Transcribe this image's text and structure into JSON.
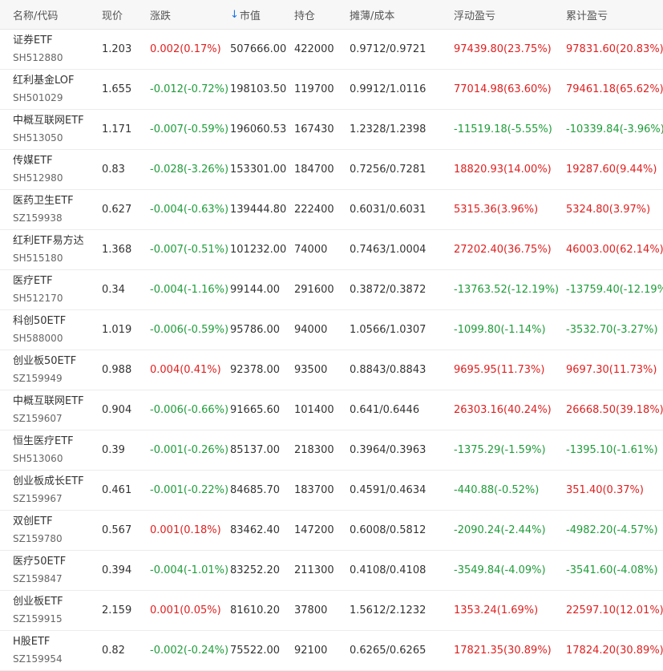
{
  "header": {
    "name_code": "名称/代码",
    "price": "现价",
    "change": "涨跌",
    "sort_arrow": "↓",
    "market_value": "市值",
    "holding": "持仓",
    "cost": "摊薄/成本",
    "float_pl": "浮动盈亏",
    "total_pl": "累计盈亏"
  },
  "colors": {
    "up": "#e02020",
    "down": "#1f9d3a",
    "sort": "#1a73e8"
  },
  "rows": [
    {
      "name": "证券ETF",
      "code": "SH512880",
      "price": "1.203",
      "change": "0.002(0.17%)",
      "change_dir": "up",
      "mv": "507666.00",
      "hold": "422000",
      "cost": "0.9712/0.9721",
      "fpl": "97439.80(23.75%)",
      "fpl_dir": "up",
      "tpl": "97831.60(20.83%)",
      "tpl_dir": "up"
    },
    {
      "name": "红利基金LOF",
      "code": "SH501029",
      "price": "1.655",
      "change": "-0.012(-0.72%)",
      "change_dir": "down",
      "mv": "198103.50",
      "hold": "119700",
      "cost": "0.9912/1.0116",
      "fpl": "77014.98(63.60%)",
      "fpl_dir": "up",
      "tpl": "79461.18(65.62%)",
      "tpl_dir": "up"
    },
    {
      "name": "中概互联网ETF",
      "code": "SH513050",
      "price": "1.171",
      "change": "-0.007(-0.59%)",
      "change_dir": "down",
      "mv": "196060.53",
      "hold": "167430",
      "cost": "1.2328/1.2398",
      "fpl": "-11519.18(-5.55%)",
      "fpl_dir": "down",
      "tpl": "-10339.84(-3.96%)",
      "tpl_dir": "down"
    },
    {
      "name": "传媒ETF",
      "code": "SH512980",
      "price": "0.83",
      "change": "-0.028(-3.26%)",
      "change_dir": "down",
      "mv": "153301.00",
      "hold": "184700",
      "cost": "0.7256/0.7281",
      "fpl": "18820.93(14.00%)",
      "fpl_dir": "up",
      "tpl": "19287.60(9.44%)",
      "tpl_dir": "up"
    },
    {
      "name": "医药卫生ETF",
      "code": "SZ159938",
      "price": "0.627",
      "change": "-0.004(-0.63%)",
      "change_dir": "down",
      "mv": "139444.80",
      "hold": "222400",
      "cost": "0.6031/0.6031",
      "fpl": "5315.36(3.96%)",
      "fpl_dir": "up",
      "tpl": "5324.80(3.97%)",
      "tpl_dir": "up"
    },
    {
      "name": "红利ETF易方达",
      "code": "SH515180",
      "price": "1.368",
      "change": "-0.007(-0.51%)",
      "change_dir": "down",
      "mv": "101232.00",
      "hold": "74000",
      "cost": "0.7463/1.0004",
      "fpl": "27202.40(36.75%)",
      "fpl_dir": "up",
      "tpl": "46003.00(62.14%)",
      "tpl_dir": "up"
    },
    {
      "name": "医疗ETF",
      "code": "SH512170",
      "price": "0.34",
      "change": "-0.004(-1.16%)",
      "change_dir": "down",
      "mv": "99144.00",
      "hold": "291600",
      "cost": "0.3872/0.3872",
      "fpl": "-13763.52(-12.19%)",
      "fpl_dir": "down",
      "tpl": "-13759.40(-12.19%)",
      "tpl_dir": "down"
    },
    {
      "name": "科创50ETF",
      "code": "SH588000",
      "price": "1.019",
      "change": "-0.006(-0.59%)",
      "change_dir": "down",
      "mv": "95786.00",
      "hold": "94000",
      "cost": "1.0566/1.0307",
      "fpl": "-1099.80(-1.14%)",
      "fpl_dir": "down",
      "tpl": "-3532.70(-3.27%)",
      "tpl_dir": "down"
    },
    {
      "name": "创业板50ETF",
      "code": "SZ159949",
      "price": "0.988",
      "change": "0.004(0.41%)",
      "change_dir": "up",
      "mv": "92378.00",
      "hold": "93500",
      "cost": "0.8843/0.8843",
      "fpl": "9695.95(11.73%)",
      "fpl_dir": "up",
      "tpl": "9697.30(11.73%)",
      "tpl_dir": "up"
    },
    {
      "name": "中概互联网ETF",
      "code": "SZ159607",
      "price": "0.904",
      "change": "-0.006(-0.66%)",
      "change_dir": "down",
      "mv": "91665.60",
      "hold": "101400",
      "cost": "0.641/0.6446",
      "fpl": "26303.16(40.24%)",
      "fpl_dir": "up",
      "tpl": "26668.50(39.18%)",
      "tpl_dir": "up"
    },
    {
      "name": "恒生医疗ETF",
      "code": "SH513060",
      "price": "0.39",
      "change": "-0.001(-0.26%)",
      "change_dir": "down",
      "mv": "85137.00",
      "hold": "218300",
      "cost": "0.3964/0.3963",
      "fpl": "-1375.29(-1.59%)",
      "fpl_dir": "down",
      "tpl": "-1395.10(-1.61%)",
      "tpl_dir": "down"
    },
    {
      "name": "创业板成长ETF",
      "code": "SZ159967",
      "price": "0.461",
      "change": "-0.001(-0.22%)",
      "change_dir": "down",
      "mv": "84685.70",
      "hold": "183700",
      "cost": "0.4591/0.4634",
      "fpl": "-440.88(-0.52%)",
      "fpl_dir": "down",
      "tpl": "351.40(0.37%)",
      "tpl_dir": "up"
    },
    {
      "name": "双创ETF",
      "code": "SZ159780",
      "price": "0.567",
      "change": "0.001(0.18%)",
      "change_dir": "up",
      "mv": "83462.40",
      "hold": "147200",
      "cost": "0.6008/0.5812",
      "fpl": "-2090.24(-2.44%)",
      "fpl_dir": "down",
      "tpl": "-4982.20(-4.57%)",
      "tpl_dir": "down"
    },
    {
      "name": "医疗50ETF",
      "code": "SZ159847",
      "price": "0.394",
      "change": "-0.004(-1.01%)",
      "change_dir": "down",
      "mv": "83252.20",
      "hold": "211300",
      "cost": "0.4108/0.4108",
      "fpl": "-3549.84(-4.09%)",
      "fpl_dir": "down",
      "tpl": "-3541.60(-4.08%)",
      "tpl_dir": "down"
    },
    {
      "name": "创业板ETF",
      "code": "SZ159915",
      "price": "2.159",
      "change": "0.001(0.05%)",
      "change_dir": "up",
      "mv": "81610.20",
      "hold": "37800",
      "cost": "1.5612/2.1232",
      "fpl": "1353.24(1.69%)",
      "fpl_dir": "up",
      "tpl": "22597.10(12.01%)",
      "tpl_dir": "up"
    },
    {
      "name": "H股ETF",
      "code": "SZ159954",
      "price": "0.82",
      "change": "-0.002(-0.24%)",
      "change_dir": "down",
      "mv": "75522.00",
      "hold": "92100",
      "cost": "0.6265/0.6265",
      "fpl": "17821.35(30.89%)",
      "fpl_dir": "up",
      "tpl": "17824.20(30.89%)",
      "tpl_dir": "up"
    }
  ]
}
